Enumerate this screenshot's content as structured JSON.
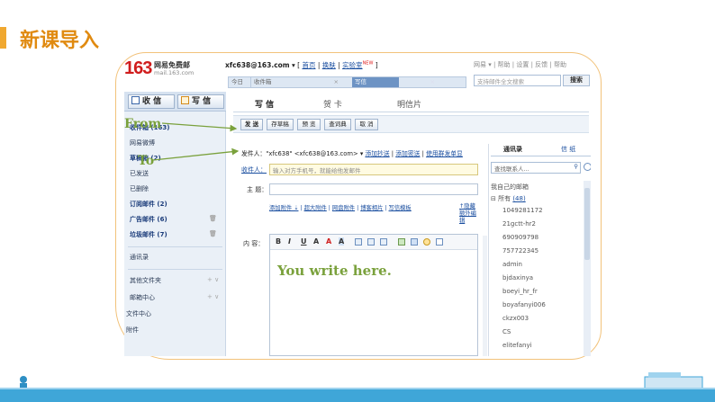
{
  "slide": {
    "title": "新课导入"
  },
  "header": {
    "logo_163": "163",
    "logo_name": "网易免费邮",
    "logo_domain": "mail.163.com",
    "account": "xfc638@163.com",
    "account_links": [
      "首页",
      "换肤",
      "实验室"
    ],
    "new_badge": "NEW",
    "top_right": "网易 ▾ | 帮助 | 设置 | 反馈 | 帮助",
    "search_placeholder": "支持邮件全文搜索",
    "search_button": "搜索"
  },
  "tabs": {
    "today": "今日",
    "inbox": "收件箱",
    "compose": "写信",
    "close": "×"
  },
  "sidebar": {
    "receive_button": "收 信",
    "write_button": "写 信",
    "items": [
      "收件箱 (163)",
      "网易微博",
      "草稿箱 (2)",
      "已发送",
      "已删除",
      "订阅邮件 (2)",
      "广告邮件 (6)",
      "垃圾邮件 (7)",
      "通讯录",
      "其他文件夹",
      "邮箱中心",
      "文件中心",
      "附件"
    ],
    "trash_glyph": "🗑",
    "expand_glyph": "+ ∨"
  },
  "compose": {
    "tabs": [
      "写 信",
      "贺 卡",
      "明信片"
    ],
    "toolbar": [
      "发 送",
      "存草稿",
      "预 览",
      "查词典",
      "取 消"
    ],
    "from_label": "发件人：",
    "from_value": "\"xfc638\" <xfc638@163.com> ▾",
    "from_links": [
      "添加抄送",
      "添加密送",
      "使用群发单显"
    ],
    "to_label": "收件人：",
    "to_placeholder": "输入对方手机号，就能给他发邮件",
    "subject_label": "主 题：",
    "attach_links": [
      "添加附件 ⇣",
      "超大附件",
      "网盘附件",
      "博客相片",
      "写信模板"
    ],
    "hide_link": "↑隐藏额外编辑",
    "content_label": "内 容：",
    "editor_buttons": [
      "B",
      "I",
      "U",
      "A",
      "A",
      "A"
    ],
    "editor_text": "You write here."
  },
  "contacts": {
    "tabs": [
      "通讯录",
      "信 纸"
    ],
    "search_placeholder": "查找联系人...",
    "search_icon": "⚲",
    "my_mailbox": "我自己的邮箱",
    "all_label": "所有",
    "all_count": "(48)",
    "entries": [
      "1049281172",
      "21gctt-hr2",
      "690909798",
      "757722345",
      "admin",
      "bjdaxinya",
      "boeyi_hr_fr",
      "boyafanyi006",
      "ckzx003",
      "CS",
      "elitefanyi"
    ]
  },
  "annotations": {
    "from": "From",
    "to": "To"
  },
  "colors": {
    "accent": "#f0a830",
    "annotation": "#7aa13c",
    "link": "#1b4fa0",
    "band": "#3fa6d8"
  }
}
